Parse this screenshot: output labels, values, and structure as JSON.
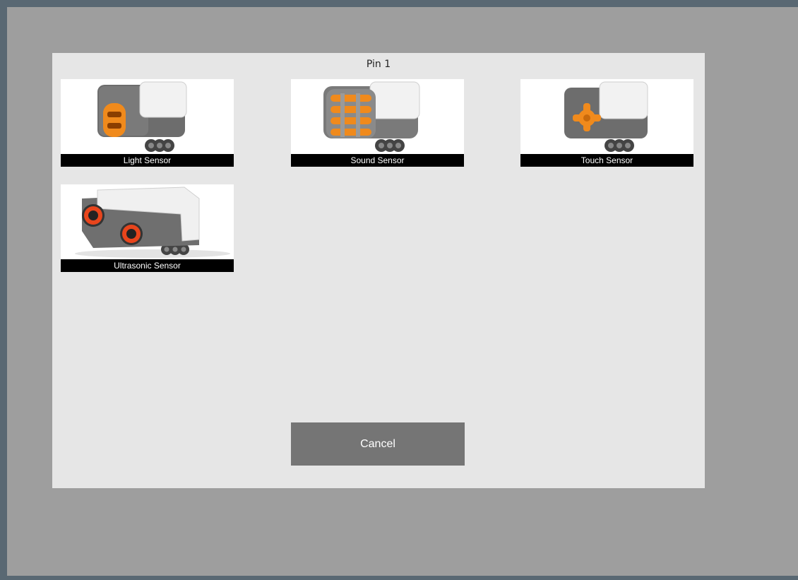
{
  "dialog": {
    "title": "Pin 1",
    "cancel_label": "Cancel"
  },
  "sensors": [
    {
      "label": "Light Sensor",
      "icon": "light-sensor-icon"
    },
    {
      "label": "Sound Sensor",
      "icon": "sound-sensor-icon"
    },
    {
      "label": "Touch Sensor",
      "icon": "touch-sensor-icon"
    },
    {
      "label": "Ultrasonic Sensor",
      "icon": "ultrasonic-sensor-icon"
    }
  ],
  "colors": {
    "window_background": "#9e9e9e",
    "dialog_background": "#e6e6e6",
    "cancel_button": "#757575",
    "sensor_accent": "#f08a1c"
  }
}
